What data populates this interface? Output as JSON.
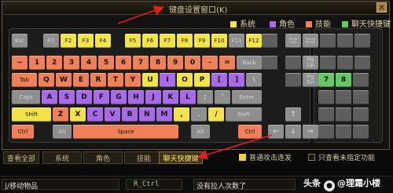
{
  "window": {
    "title": "键盘设置窗口(K)",
    "close_label": "✕"
  },
  "legend": [
    {
      "label": "系统",
      "color": "#f3e34a"
    },
    {
      "label": "角色",
      "color": "#a86ae8"
    },
    {
      "label": "技能",
      "color": "#f08058"
    },
    {
      "label": "聊天快捷键",
      "color": "#64c864"
    }
  ],
  "colors": {
    "gray": "#8e8e8e",
    "yellow": "#f3e34a",
    "purple": "#a86ae8",
    "orange": "#f08058",
    "green": "#64c864"
  },
  "keys": {
    "esc": "Esc",
    "f1": "F1",
    "f2": "F2",
    "f3": "F3",
    "f4": "F4",
    "f5": "F5",
    "f6": "F6",
    "f7": "F7",
    "f8": "F8",
    "f9": "F9",
    "f10": "F10",
    "f11": "F11",
    "f12": "F12",
    "scroll": "Scroll Lock",
    "pause": "Pause Break",
    "grave": "~",
    "n1": "1",
    "n2": "2",
    "n3": "3",
    "n4": "4",
    "n5": "5",
    "n6": "6",
    "n7": "7",
    "n8": "8",
    "n9": "9",
    "n0": "0",
    "minus": "-",
    "equal": "=",
    "back": "Back",
    "tab": "Tab",
    "q": "Q",
    "w": "W",
    "e": "E",
    "r": "R",
    "t": "T",
    "y": "Y",
    "u": "U",
    "i": "I",
    "o": "O",
    "p": "P",
    "lbr": "[",
    "rbr": "]",
    "bslash": "\\",
    "caps": "Caps",
    "a": "A",
    "s": "S",
    "d": "D",
    "f": "F",
    "g": "G",
    "h": "H",
    "j": "J",
    "k": "K",
    "l": "L",
    "semi": ";",
    "quote": "'",
    "enter": "Enter",
    "lshift": "Shift",
    "z": "Z",
    "x": "X",
    "c": "C",
    "v": "V",
    "b": "B",
    "n": "N",
    "m": "M",
    "comma": ",",
    "period": ".",
    "slash": "/",
    "rshift": "Shift",
    "lctrl": "Ctrl",
    "lalt": "Alt",
    "space": "Space",
    "ralt": "Alt",
    "rctrl": "Ctrl",
    "pgup": "Pg Up",
    "pgdn": "Pg Dn",
    "up": "↑",
    "left": "←",
    "down": "↓",
    "right": "→",
    "np7": "7",
    "np8": "8"
  },
  "tabs": [
    "查看全部",
    "系统",
    "角色",
    "技能",
    "聊天快捷键"
  ],
  "options": [
    {
      "label": "普通攻击连发",
      "checked": true
    },
    {
      "label": "只查看未指定功能",
      "checked": false
    }
  ],
  "status": {
    "left": "|/移动物品",
    "mid_key": "R_Ctrl",
    "message": "没有拉人次数了"
  },
  "watermark": {
    "prefix": "头条",
    "handle": "@理霜小楼"
  }
}
